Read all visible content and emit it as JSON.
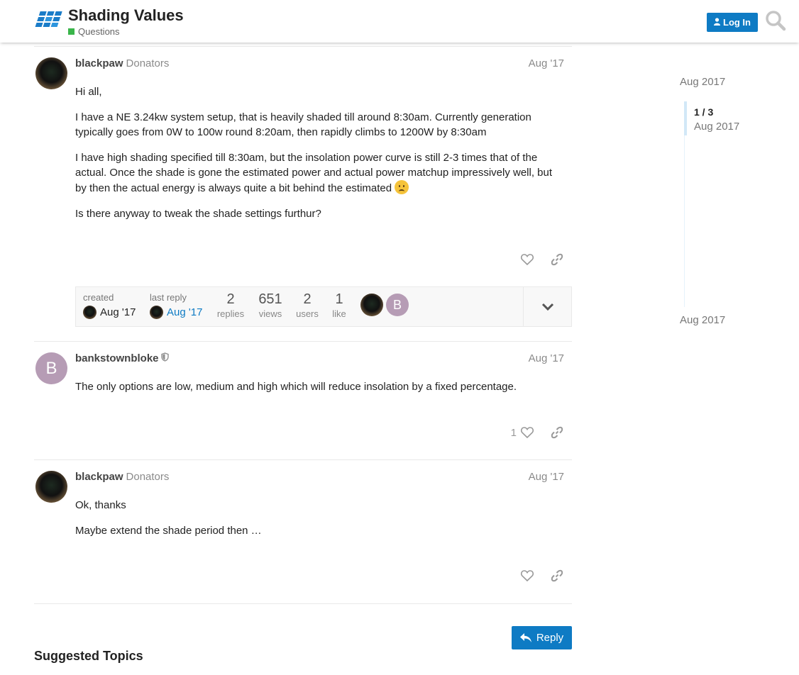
{
  "header": {
    "title": "Shading Values",
    "category": "Questions",
    "category_color": "#3ab54a",
    "login_label": "Log In",
    "accent_color": "#0e7bc4"
  },
  "posts": [
    {
      "username": "blackpaw",
      "user_title": "Donators",
      "date": "Aug '17",
      "paragraphs": [
        "Hi all,",
        "I have a NE 3.24kw system setup, that is heavily shaded till around 8:30am. Currently generation typically goes from 0W to 100w round 8:20am, then rapidly climbs to 1200W by 8:30am",
        "I have high shading specified till 8:30am, but the insolation power curve is still 2-3 times that of the actual. Once the shade is gone the estimated power and actual power matchup impressively well, but by then the actual energy is always quite a bit behind the estimated",
        "Is there anyway to tweak the shade settings furthur?"
      ]
    },
    {
      "username": "bankstownbloke",
      "avatar_letter": "B",
      "date": "Aug '17",
      "paragraphs": [
        "The only options are low, medium and high which will reduce insolation by a fixed percentage."
      ],
      "like_count": "1"
    },
    {
      "username": "blackpaw",
      "user_title": "Donators",
      "date": "Aug '17",
      "paragraphs": [
        "Ok, thanks",
        "Maybe extend the shade period then …"
      ]
    }
  ],
  "topic_map": {
    "created_label": "created",
    "created_date": "Aug '17",
    "last_reply_label": "last reply",
    "last_reply_date": "Aug '17",
    "stats": [
      {
        "value": "2",
        "label": "replies"
      },
      {
        "value": "651",
        "label": "views"
      },
      {
        "value": "2",
        "label": "users"
      },
      {
        "value": "1",
        "label": "like"
      }
    ],
    "participant_letter": "B"
  },
  "timeline": {
    "top_date": "Aug 2017",
    "position": "1 / 3",
    "position_date": "Aug 2017",
    "bottom_date": "Aug 2017"
  },
  "reply_label": "Reply",
  "suggested_heading": "Suggested Topics"
}
